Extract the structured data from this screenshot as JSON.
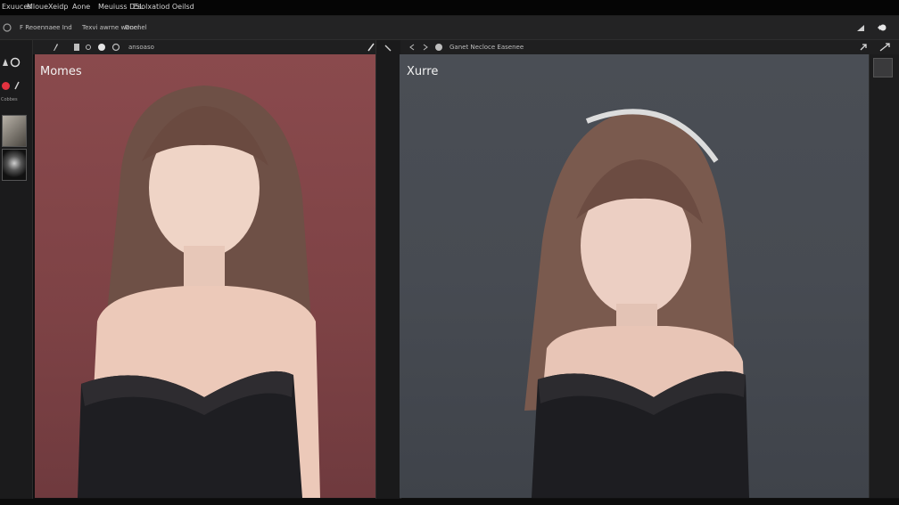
{
  "menubar": {
    "items": [
      "Exuuces",
      "Mloue",
      "Xeidp",
      "Aone",
      "Meuiuss D5L",
      "Esolxatiod Oeilsd"
    ]
  },
  "toolbar": {
    "left_text": "F Reoennaee Ind",
    "mid_text": "Texvi awrne wenel",
    "mid_text2": "Doenel"
  },
  "left_panel": {
    "header_text": "ansoaso",
    "canvas_label": "Momes",
    "strip_text": "Cobbes"
  },
  "right_panel": {
    "header_text": "Ganet Necloce Easenee",
    "canvas_label": "Xurre"
  },
  "colors": {
    "left_bg": "#834649",
    "right_bg": "#484c53",
    "app_bg": "#101011",
    "accent_red": "#e2323f"
  }
}
